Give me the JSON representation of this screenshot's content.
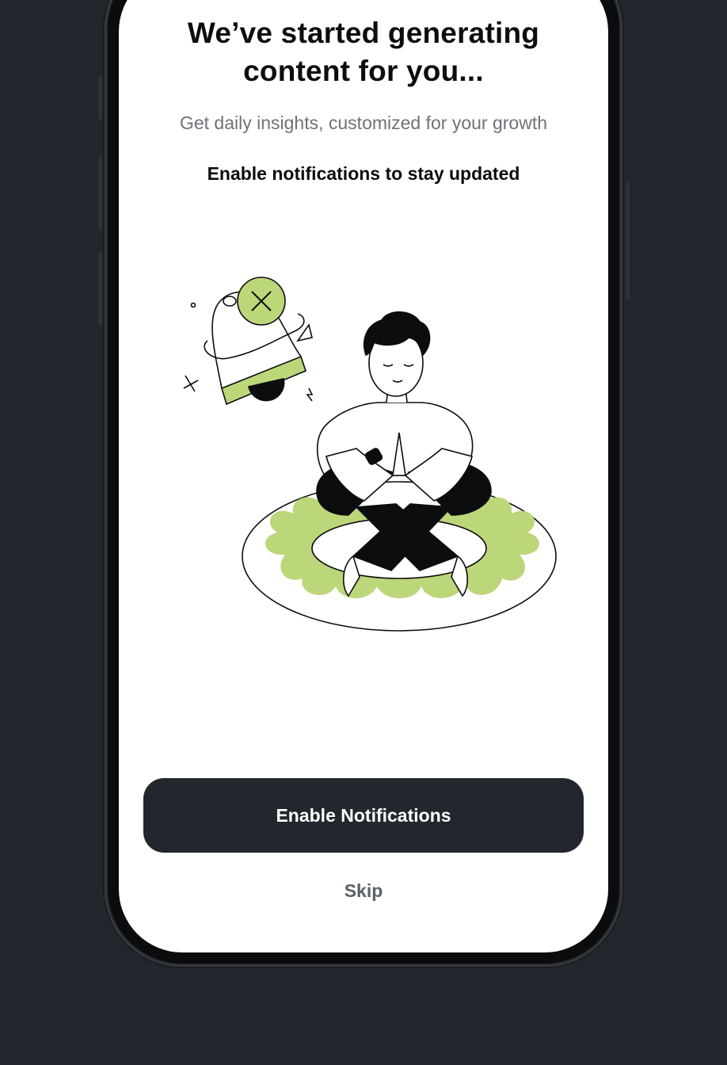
{
  "screen": {
    "title_line1": "We’ve started generating",
    "title_line2": "content for you...",
    "subtitle": "Get daily insights, customized for your growth",
    "emphasis": "Enable notifications to stay updated"
  },
  "actions": {
    "enable_label": "Enable Notifications",
    "skip_label": "Skip"
  },
  "illustration": {
    "subject": "person-meditating-icon",
    "bell": "notification-bell-icon"
  },
  "colors": {
    "background": "#22262d",
    "accent_green": "#bcd67a",
    "primary_button": "#22262d",
    "skip_text": "#5a6069"
  }
}
